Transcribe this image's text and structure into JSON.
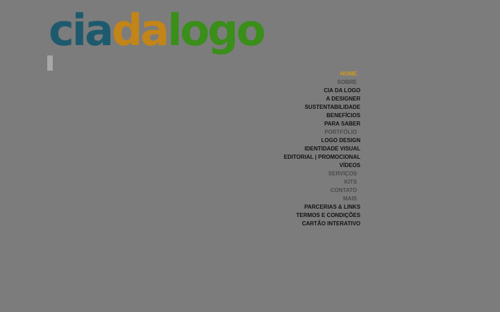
{
  "logo": {
    "parts": [
      {
        "text": "cia",
        "color": "#1e5a6e"
      },
      {
        "text": "da",
        "color": "#c38418"
      },
      {
        "text": "logo",
        "color": "#3a8e1a"
      }
    ]
  },
  "nav": {
    "items": [
      {
        "label": "HOME",
        "level": "top",
        "active": true
      },
      {
        "label": "SOBRE",
        "level": "top"
      },
      {
        "label": "CIA DA LOGO",
        "level": "sub"
      },
      {
        "label": "A DESIGNER",
        "level": "sub"
      },
      {
        "label": "SUSTENTABILIDADE",
        "level": "sub"
      },
      {
        "label": "BENEFÍCIOS",
        "level": "sub"
      },
      {
        "label": "PARA SABER",
        "level": "sub"
      },
      {
        "label": "PORTFÓLIO",
        "level": "top"
      },
      {
        "label": "LOGO DESIGN",
        "level": "sub"
      },
      {
        "label": "IDENTIDADE VISUAL",
        "level": "sub"
      },
      {
        "label": "EDITORIAL | PROMOCIONAL",
        "level": "sub"
      },
      {
        "label": "VÍDEOS",
        "level": "sub"
      },
      {
        "label": "SERVIÇOS",
        "level": "top"
      },
      {
        "label": "KITS",
        "level": "top"
      },
      {
        "label": "CONTATO",
        "level": "top"
      },
      {
        "label": "MAIS",
        "level": "top"
      },
      {
        "label": "PARCERIAS & LINKS",
        "level": "sub"
      },
      {
        "label": "TERMOS E CONDIÇÕES",
        "level": "sub"
      },
      {
        "label": "CARTÃO INTERATIVO",
        "level": "sub"
      }
    ]
  }
}
